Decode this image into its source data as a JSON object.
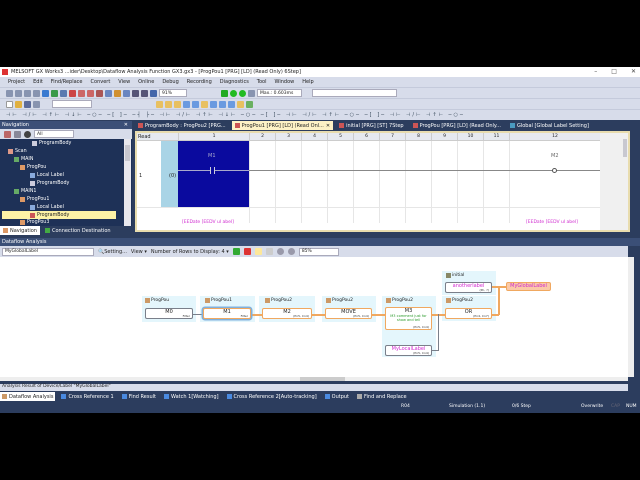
{
  "window": {
    "title": "MELSOFT GX Works3 ...ider\\Desktop\\Dataflow Analysis Function GX3.gx3 - [ProgPou1 [PRG] [LD] (Read Only) 6Step]"
  },
  "menu": [
    "Project",
    "Edit",
    "Find/Replace",
    "Convert",
    "View",
    "Online",
    "Debug",
    "Recording",
    "Diagnostics",
    "Tool",
    "Window",
    "Help"
  ],
  "toolbar": {
    "zoom": "91%",
    "scan_time": "Max.: 0.603ms",
    "empty_combo": ""
  },
  "navigation": {
    "title": "Navigation",
    "filter": "All",
    "tree": [
      {
        "label": "ProgramBody",
        "depth": 3
      },
      {
        "label": "Scan",
        "depth": 0
      },
      {
        "label": "MAIN",
        "depth": 1
      },
      {
        "label": "ProgPou",
        "depth": 2
      },
      {
        "label": "Local Label",
        "depth": 3
      },
      {
        "label": "ProgramBody",
        "depth": 3
      },
      {
        "label": "MAIN1",
        "depth": 1
      },
      {
        "label": "ProgPou1",
        "depth": 2
      },
      {
        "label": "Local Label",
        "depth": 3
      },
      {
        "label": "ProgramBody",
        "depth": 3,
        "selected": true
      },
      {
        "label": "ProgPou3",
        "depth": 2
      }
    ],
    "tabs": [
      "Navigation",
      "Connection Destination"
    ]
  },
  "doc_tabs": [
    {
      "label": "ProgramBody : ProgPou2 [PRG..."
    },
    {
      "label": "ProgPou1 [PRG] [LD] (Read Onl...",
      "active": true
    },
    {
      "label": "initial [PRG] [ST] 7Step"
    },
    {
      "label": "ProgPou [PRG] [LD] (Read Only..."
    },
    {
      "label": "Global [Global Label Setting]"
    }
  ],
  "ladder": {
    "mode": "Read",
    "columns": [
      "1",
      "2",
      "3",
      "4",
      "5",
      "6",
      "7",
      "8",
      "9",
      "10",
      "11",
      "12"
    ],
    "row_number": "1",
    "step": "(0)",
    "contact": "M1",
    "coil": "M2",
    "comment_left": "[EEDate [EEDV ul abel]",
    "comment_right": "[EEDate [EEDV ul abel]"
  },
  "dataflow": {
    "title": "Dataflow Analysis",
    "target": "MyGlobalLabel",
    "setting": "Setting...",
    "view": "View",
    "rows": "Number of Rows to Display: 4",
    "zoom": "85%",
    "nodes": {
      "n0": {
        "group": "ProgPou",
        "label": "M0",
        "sub": "Filter"
      },
      "n1": {
        "group": "ProgPou1",
        "label": "M1",
        "sub": "Filter"
      },
      "n2": {
        "group": "ProgPou2",
        "label": "M2",
        "sub": "(Pn5, Cn4)"
      },
      "n3": {
        "group": "ProgPou2",
        "label": "MOVE",
        "sub": "(Pn5, Cn4)"
      },
      "n4": {
        "group": "ProgPou2",
        "label": "M3",
        "comment": "M3 comment just for show and tell",
        "sub": "(Pn5, Cn4)"
      },
      "n5": {
        "group": "ProgPou2",
        "label": "OR",
        "sub": "(Pn4, Cn7)"
      },
      "n6": {
        "group": "initial",
        "label": "anotherlabel",
        "sub": "(Pn, ?)"
      },
      "n7": {
        "label": "MyGlobalLabel"
      },
      "n8": {
        "label": "MyLocalLabel",
        "sub": "(Pn5, Cn4)"
      }
    },
    "result": "Analysis Result of Device/Label \"MyGlobalLabel\""
  },
  "bottom_tabs": [
    "Dataflow Analysis",
    "Cross Reference 1",
    "Find Result",
    "Watch 1[Watching]",
    "Cross Reference 2[Auto-tracking]",
    "Output",
    "Find and Replace"
  ],
  "status": {
    "r": "R04",
    "sim": "Simulation (1.1)",
    "step": "0/6 Step",
    "mode": "Overwrite",
    "cap": "CAP",
    "num": "NUM"
  },
  "colors": {
    "nav_bg": "#1e3157",
    "chrome": "#2c3d5e",
    "ladder_selection": "#0a0a9e",
    "wire": "#f0a860",
    "label_text": "#d02cd0",
    "comment_text": "#2a9a2a"
  }
}
